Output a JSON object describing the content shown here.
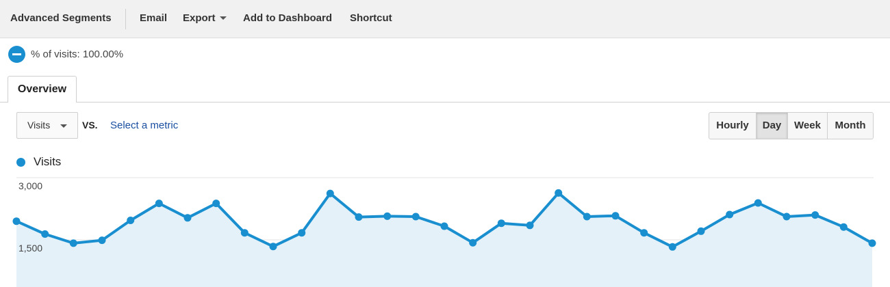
{
  "toolbar": {
    "advanced_segments": "Advanced Segments",
    "email": "Email",
    "export": "Export",
    "add_to_dashboard": "Add to Dashboard",
    "shortcut": "Shortcut"
  },
  "segment": {
    "label": "% of visits: 100.00%",
    "icon": "segment-pie-icon",
    "color": "#1a8fd0"
  },
  "tabs": [
    {
      "label": "Overview",
      "active": true
    }
  ],
  "metric_selector": {
    "selected": "Visits",
    "vs": "VS.",
    "select_metric": "Select a metric"
  },
  "granularity": {
    "options": [
      "Hourly",
      "Day",
      "Week",
      "Month"
    ],
    "selected": "Day"
  },
  "legend": {
    "series_name": "Visits",
    "color": "#1a8fd0"
  },
  "colors": {
    "accent": "#1a8fd0",
    "area_fill": "#e4f1f9",
    "link": "#1a4fa0"
  },
  "chart_data": {
    "type": "area",
    "series": [
      {
        "name": "Visits",
        "values": [
          1950,
          1640,
          1420,
          1490,
          1970,
          2380,
          2030,
          2380,
          1670,
          1340,
          1670,
          2620,
          2050,
          2070,
          2060,
          1830,
          1430,
          1900,
          1850,
          2630,
          2060,
          2080,
          1670,
          1330,
          1710,
          2110,
          2390,
          2060,
          2100,
          1810,
          1420
        ]
      }
    ],
    "y_ticks": [
      {
        "value": 3000,
        "label": "3,000"
      },
      {
        "value": 1500,
        "label": "1,500"
      }
    ],
    "grid": true,
    "legend_position": "top-left"
  }
}
